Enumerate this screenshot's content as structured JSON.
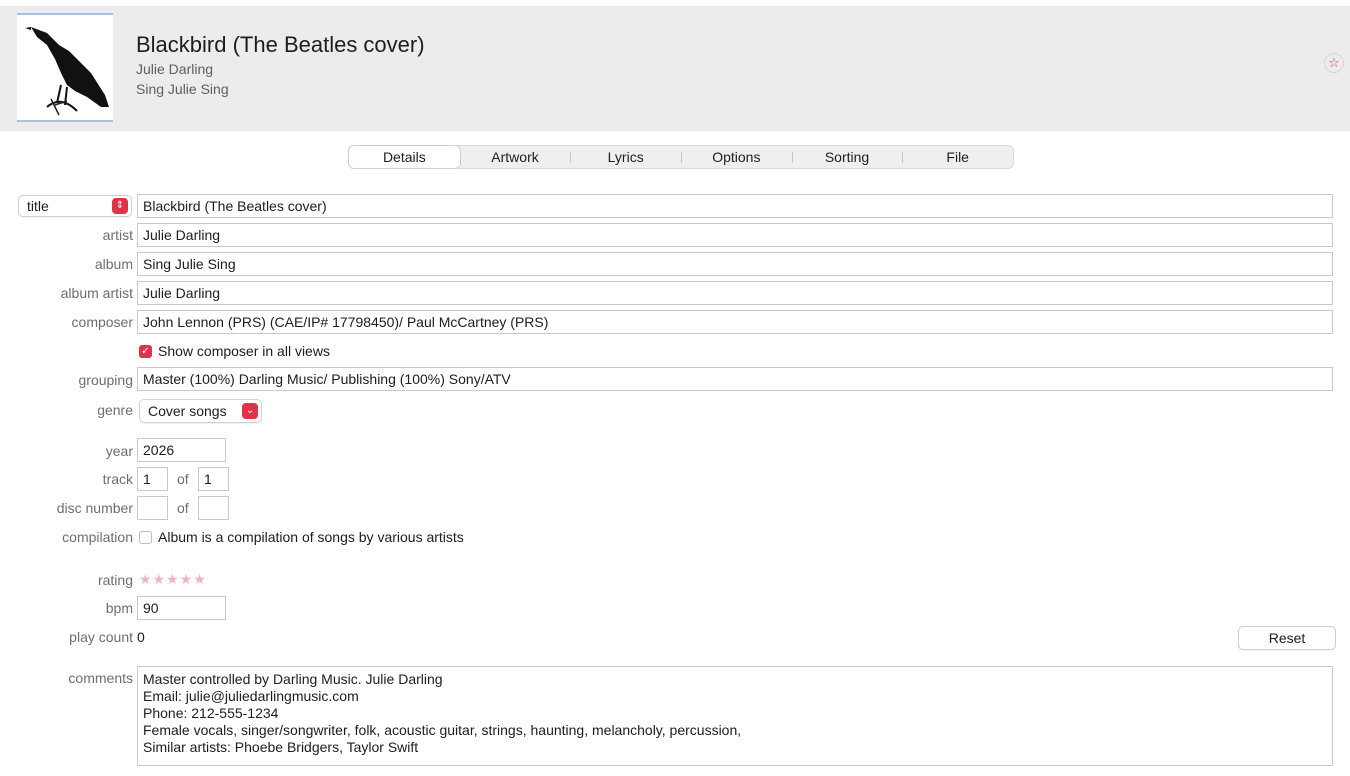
{
  "header": {
    "song_title": "Blackbird (The Beatles cover)",
    "artist": "Julie Darling",
    "album": "Sing Julie Sing",
    "love_icon": "star-outline-icon",
    "artwork_icon": "blackbird-artwork-icon"
  },
  "tabs": [
    {
      "label": "Details",
      "active": true
    },
    {
      "label": "Artwork",
      "active": false
    },
    {
      "label": "Lyrics",
      "active": false
    },
    {
      "label": "Options",
      "active": false
    },
    {
      "label": "Sorting",
      "active": false
    },
    {
      "label": "File",
      "active": false
    }
  ],
  "fields": {
    "title_selector": "title",
    "title": "Blackbird (The Beatles cover)",
    "artist_label": "artist",
    "artist": "Julie Darling",
    "album_label": "album",
    "album": "Sing Julie Sing",
    "album_artist_label": "album artist",
    "album_artist": "Julie Darling",
    "composer_label": "composer",
    "composer": "John Lennon (PRS) (CAE/IP# 17798450)/ Paul McCartney (PRS)",
    "show_composer_label": "Show composer in all views",
    "show_composer_checked": true,
    "grouping_label": "grouping",
    "grouping": "Master (100%) Darling Music/ Publishing (100%) Sony/ATV",
    "genre_label": "genre",
    "genre": "Cover songs",
    "year_label": "year",
    "year": "2026",
    "track_label": "track",
    "track": "1",
    "of_label": "of",
    "track_of": "1",
    "disc_label": "disc number",
    "disc": "",
    "disc_of": "",
    "compilation_label": "compilation",
    "compilation_text": "Album is a compilation of songs by various artists",
    "compilation_checked": false,
    "rating_label": "rating",
    "rating_stars": "★★★★★",
    "rating_value": 0,
    "bpm_label": "bpm",
    "bpm": "90",
    "play_count_label": "play count",
    "play_count": "0",
    "reset_label": "Reset",
    "comments_label": "comments",
    "comments": [
      "Master controlled by Darling Music. Julie Darling",
      "Email: julie@juliedarlingmusic.com",
      "Phone: 212-555-1234",
      "Female vocals, singer/songwriter, folk, acoustic guitar, strings, haunting, melancholy, percussion,",
      "Similar artists: Phoebe Bridgers, Taylor Swift"
    ]
  },
  "colors": {
    "accent": "#e0334a",
    "header_bg": "#ececec"
  }
}
